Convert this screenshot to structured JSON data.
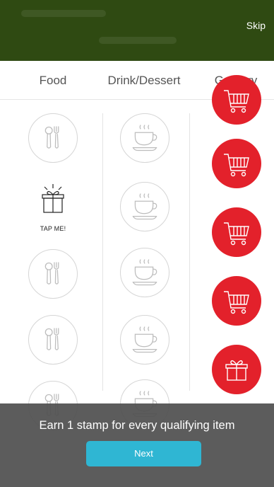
{
  "header": {
    "skip_label": "Skip"
  },
  "tabs": [
    {
      "label": "Food"
    },
    {
      "label": "Drink/Dessert"
    },
    {
      "label": "Grocery"
    }
  ],
  "reward": {
    "label": "TAP ME!"
  },
  "overlay": {
    "message": "Earn 1 stamp for every qualifying item",
    "next_label": "Next"
  },
  "colors": {
    "header_bg": "#2f4a12",
    "stamp_active": "#e3212b",
    "next_button": "#2fb6d3",
    "overlay_bg": "#505050"
  },
  "columns": {
    "food": {
      "icon": "utensils-icon",
      "stamps": [
        "empty",
        "reward",
        "empty",
        "empty",
        "empty"
      ]
    },
    "drink": {
      "icon": "coffee-cup-icon",
      "stamps": [
        "empty",
        "empty",
        "empty",
        "empty",
        "empty"
      ]
    },
    "grocery": {
      "icon": "shopping-cart-icon",
      "stamps": [
        "filled",
        "filled",
        "filled",
        "filled",
        "reward"
      ]
    }
  }
}
